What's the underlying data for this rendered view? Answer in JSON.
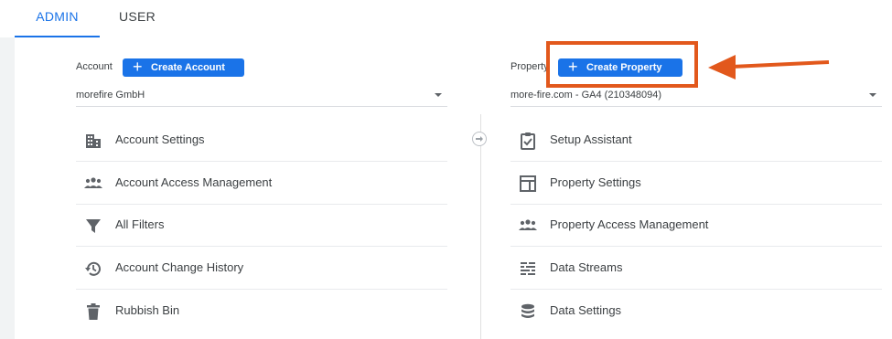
{
  "tabs": {
    "admin": "ADMIN",
    "user": "USER"
  },
  "account": {
    "label": "Account",
    "create_button": "Create Account",
    "selected": "morefire GmbH",
    "items": [
      {
        "label": "Account Settings",
        "icon": "building-icon"
      },
      {
        "label": "Account Access Management",
        "icon": "people-icon"
      },
      {
        "label": "All Filters",
        "icon": "filter-icon"
      },
      {
        "label": "Account Change History",
        "icon": "history-icon"
      },
      {
        "label": "Rubbish Bin",
        "icon": "trash-icon"
      }
    ]
  },
  "property": {
    "label": "Property",
    "create_button": "Create Property",
    "selected": "more-fire.com - GA4 (210348094)",
    "items": [
      {
        "label": "Setup Assistant",
        "icon": "checklist-icon"
      },
      {
        "label": "Property Settings",
        "icon": "layout-icon"
      },
      {
        "label": "Property Access Management",
        "icon": "people-icon"
      },
      {
        "label": "Data Streams",
        "icon": "streams-icon"
      },
      {
        "label": "Data Settings",
        "icon": "database-icon"
      }
    ]
  },
  "colors": {
    "accent": "#1a73e8",
    "annotation": "#e2581c",
    "icon": "#5f6368"
  }
}
